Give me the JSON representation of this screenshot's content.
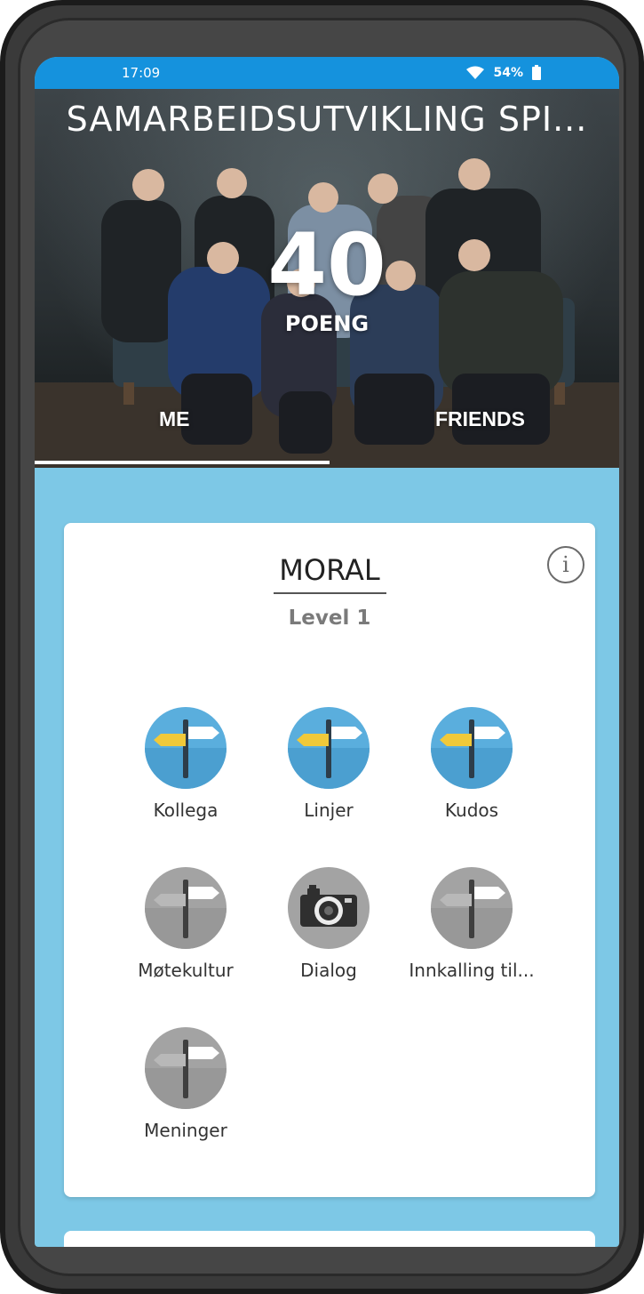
{
  "status_bar": {
    "time": "17:09",
    "battery": "54%"
  },
  "hero": {
    "title": "SAMARBEIDSUTVIKLING SPI...",
    "score": "40",
    "score_label": "POENG",
    "tabs": [
      {
        "label": "ME",
        "active": true
      },
      {
        "label": "FRIENDS",
        "active": false
      }
    ]
  },
  "card": {
    "title": "MORAL",
    "level": "Level 1",
    "info_icon": "info-icon",
    "badges": [
      {
        "label": "Kollega",
        "icon": "signpost-icon",
        "state": "unlocked"
      },
      {
        "label": "Linjer",
        "icon": "signpost-icon",
        "state": "unlocked"
      },
      {
        "label": "Kudos",
        "icon": "signpost-icon",
        "state": "unlocked"
      },
      {
        "label": "Møtekultur",
        "icon": "signpost-icon",
        "state": "locked"
      },
      {
        "label": "Dialog",
        "icon": "camera-icon",
        "state": "locked"
      },
      {
        "label": "Innkalling til...",
        "icon": "signpost-icon",
        "state": "locked"
      },
      {
        "label": "Meninger",
        "icon": "signpost-icon",
        "state": "locked"
      }
    ]
  },
  "colors": {
    "status_bar": "#1592dd",
    "background": "#7dc8e6",
    "badge_unlocked": "#5aaedd",
    "badge_locked": "#a3a3a3",
    "sign_yellow": "#f0c93a"
  }
}
